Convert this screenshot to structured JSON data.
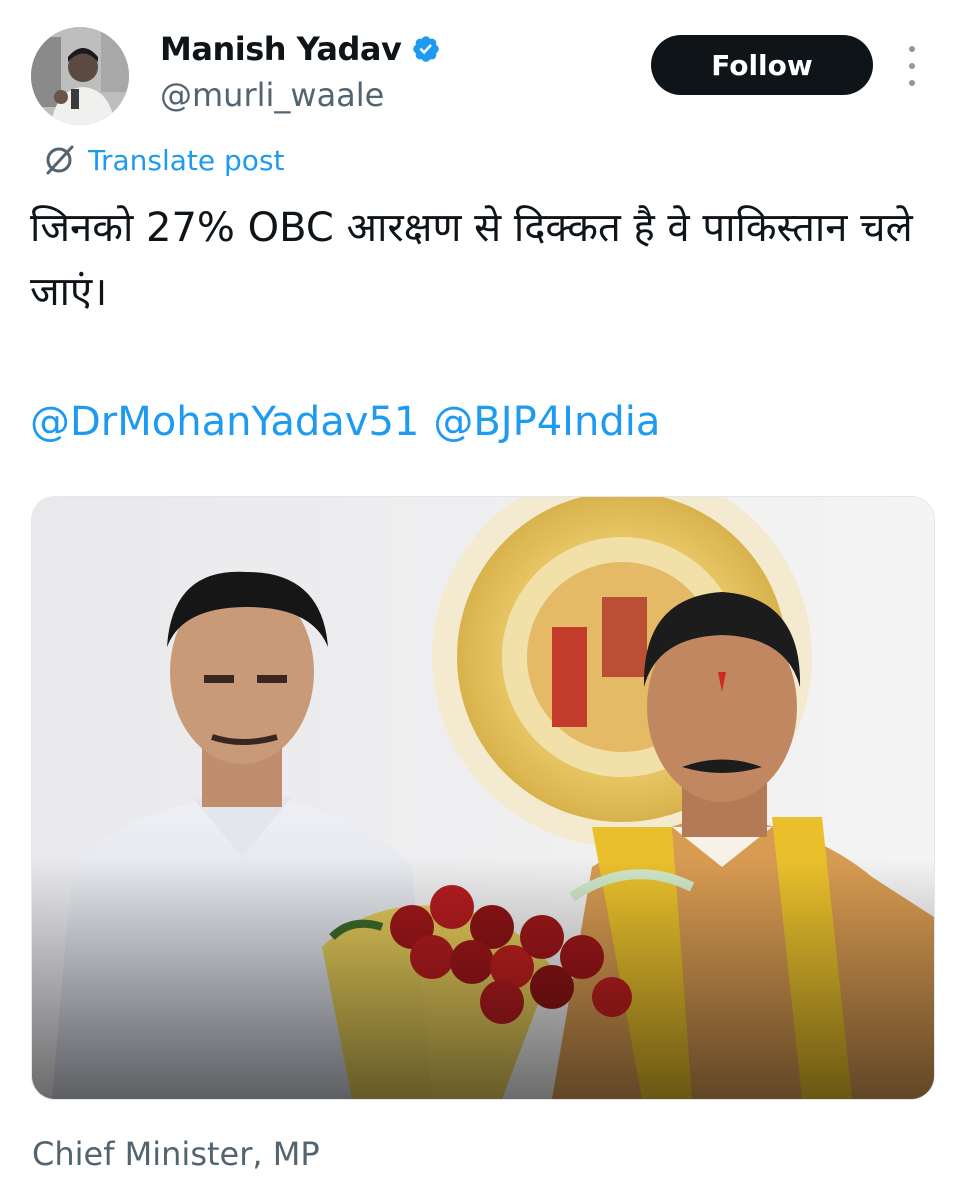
{
  "author": {
    "display_name": "Manish Yadav",
    "handle": "@murli_waale",
    "verified": true,
    "avatar_icon": "user-avatar-photo"
  },
  "actions": {
    "follow_label": "Follow",
    "more_icon": "vertical-ellipsis-icon"
  },
  "translate": {
    "icon": "translate-globe-icon",
    "label": "Translate post"
  },
  "post": {
    "text": "जिनको 27% OBC आरक्षण से दिक्कत है वे पाकिस्तान चले जाएं।",
    "mentions": [
      "@DrMohanYadav51",
      "@BJP4India"
    ]
  },
  "media": {
    "type": "photo",
    "caption": "Chief Minister, MP"
  },
  "colors": {
    "text_primary": "#0f1419",
    "text_secondary": "#536471",
    "link": "#1d9bf0",
    "verified_badge": "#1d9bf0",
    "follow_bg": "#0f1419",
    "follow_text": "#ffffff"
  }
}
